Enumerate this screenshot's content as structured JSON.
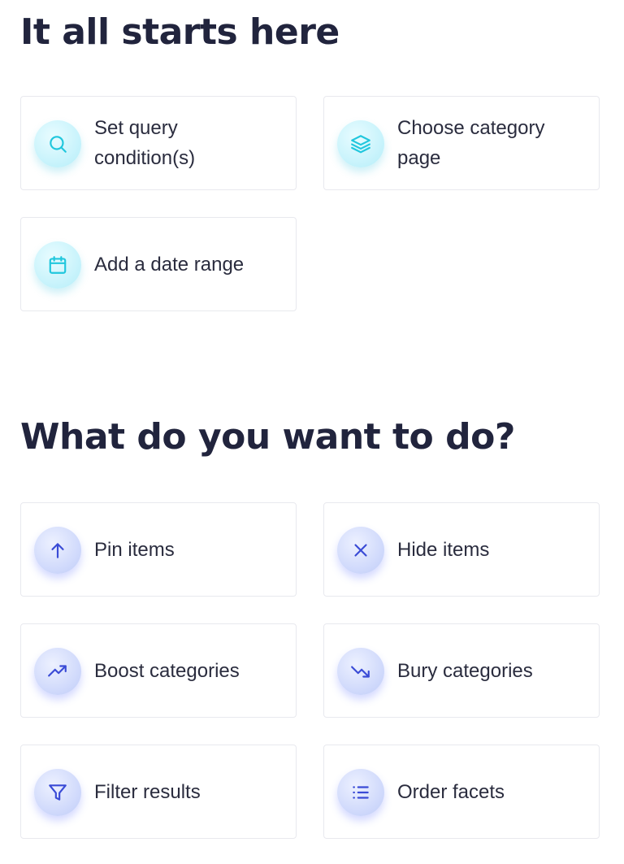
{
  "section1": {
    "title": "It all starts here",
    "cards": [
      {
        "label": "Set query condition(s)",
        "icon": "search-icon"
      },
      {
        "label": "Choose category page",
        "icon": "layers-icon"
      },
      {
        "label": "Add a date range",
        "icon": "calendar-icon"
      }
    ]
  },
  "section2": {
    "title": "What do you want to do?",
    "cards": [
      {
        "label": "Pin items",
        "icon": "arrow-up-icon"
      },
      {
        "label": "Hide items",
        "icon": "close-icon"
      },
      {
        "label": "Boost categories",
        "icon": "trending-up-icon"
      },
      {
        "label": "Bury categories",
        "icon": "trending-down-icon"
      },
      {
        "label": "Filter results",
        "icon": "filter-icon"
      },
      {
        "label": "Order facets",
        "icon": "list-icon"
      }
    ]
  },
  "colors": {
    "heading": "#21243d",
    "teal_accent": "#21c7dd",
    "blue_accent": "#3a4bd6",
    "card_border": "#e8e9ee"
  }
}
